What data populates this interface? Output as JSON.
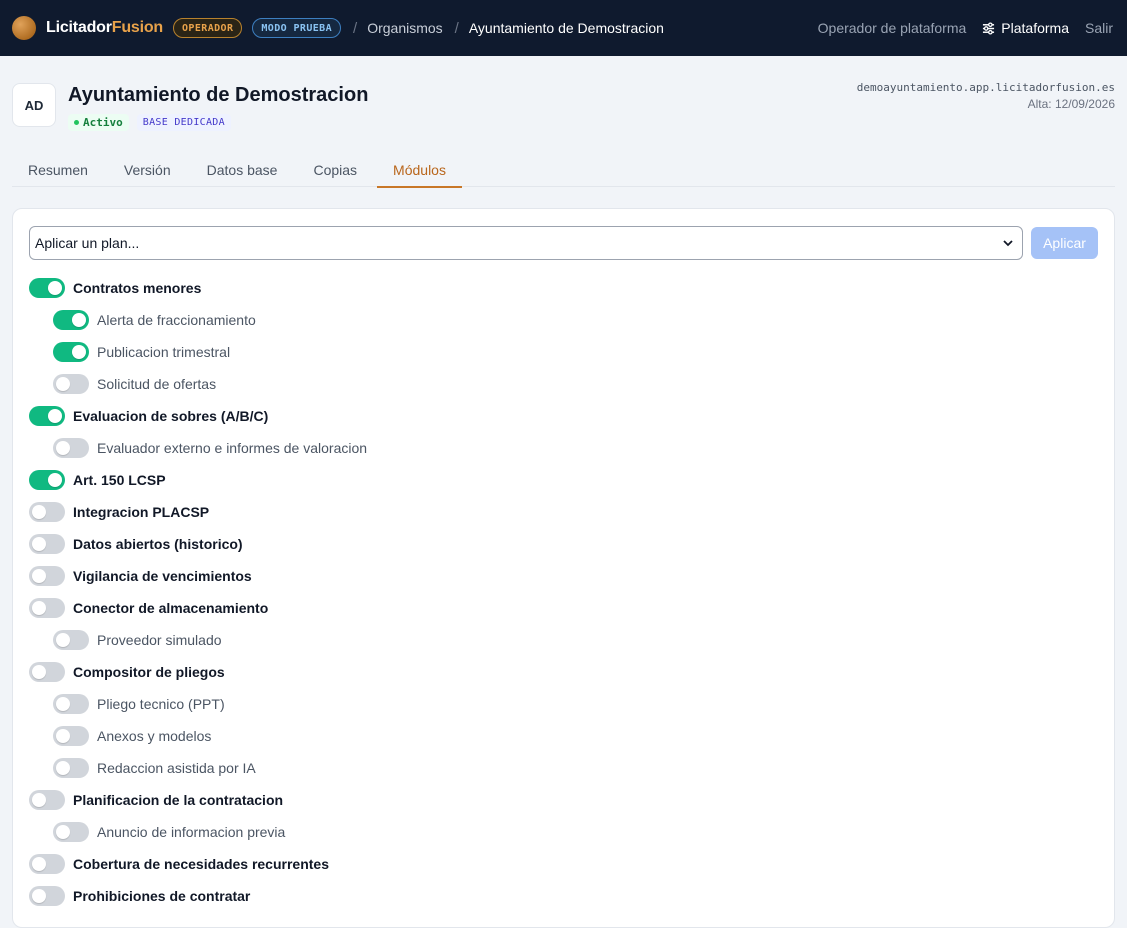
{
  "topbar": {
    "logo_part1": "Licitador",
    "logo_part2": "Fusion",
    "badge_operador": "OPERADOR",
    "badge_modo": "MODO PRUEBA",
    "breadcrumb": [
      "Organismos",
      "Ayuntamiento de Demostracion"
    ],
    "operator_link": "Operador de plataforma",
    "platform_link": "Plataforma",
    "logout": "Salir"
  },
  "org": {
    "initials": "AD",
    "name": "Ayuntamiento de Demostracion",
    "status": "Activo",
    "base_type": "BASE DEDICADA",
    "domain": "demoayuntamiento.app.licitadorfusion.es",
    "alta": "Alta: 12/09/2026"
  },
  "tabs": [
    {
      "label": "Resumen",
      "active": false
    },
    {
      "label": "Versión",
      "active": false
    },
    {
      "label": "Datos base",
      "active": false
    },
    {
      "label": "Copias",
      "active": false
    },
    {
      "label": "Módulos",
      "active": true
    }
  ],
  "plan": {
    "select_value": "Aplicar un plan...",
    "apply_label": "Aplicar"
  },
  "modules": [
    {
      "label": "Contratos menores",
      "level": 0,
      "on": true
    },
    {
      "label": "Alerta de fraccionamiento",
      "level": 1,
      "on": true
    },
    {
      "label": "Publicacion trimestral",
      "level": 1,
      "on": true
    },
    {
      "label": "Solicitud de ofertas",
      "level": 1,
      "on": false
    },
    {
      "label": "Evaluacion de sobres (A/B/C)",
      "level": 0,
      "on": true
    },
    {
      "label": "Evaluador externo e informes de valoracion",
      "level": 1,
      "on": false
    },
    {
      "label": "Art. 150 LCSP",
      "level": 0,
      "on": true
    },
    {
      "label": "Integracion PLACSP",
      "level": 0,
      "on": false
    },
    {
      "label": "Datos abiertos (historico)",
      "level": 0,
      "on": false
    },
    {
      "label": "Vigilancia de vencimientos",
      "level": 0,
      "on": false
    },
    {
      "label": "Conector de almacenamiento",
      "level": 0,
      "on": false
    },
    {
      "label": "Proveedor simulado",
      "level": 1,
      "on": false
    },
    {
      "label": "Compositor de pliegos",
      "level": 0,
      "on": false
    },
    {
      "label": "Pliego tecnico (PPT)",
      "level": 1,
      "on": false
    },
    {
      "label": "Anexos y modelos",
      "level": 1,
      "on": false
    },
    {
      "label": "Redaccion asistida por IA",
      "level": 1,
      "on": false
    },
    {
      "label": "Planificacion de la contratacion",
      "level": 0,
      "on": false
    },
    {
      "label": "Anuncio de informacion previa",
      "level": 1,
      "on": false
    },
    {
      "label": "Cobertura de necesidades recurrentes",
      "level": 0,
      "on": false
    },
    {
      "label": "Prohibiciones de contratar",
      "level": 0,
      "on": false
    }
  ]
}
